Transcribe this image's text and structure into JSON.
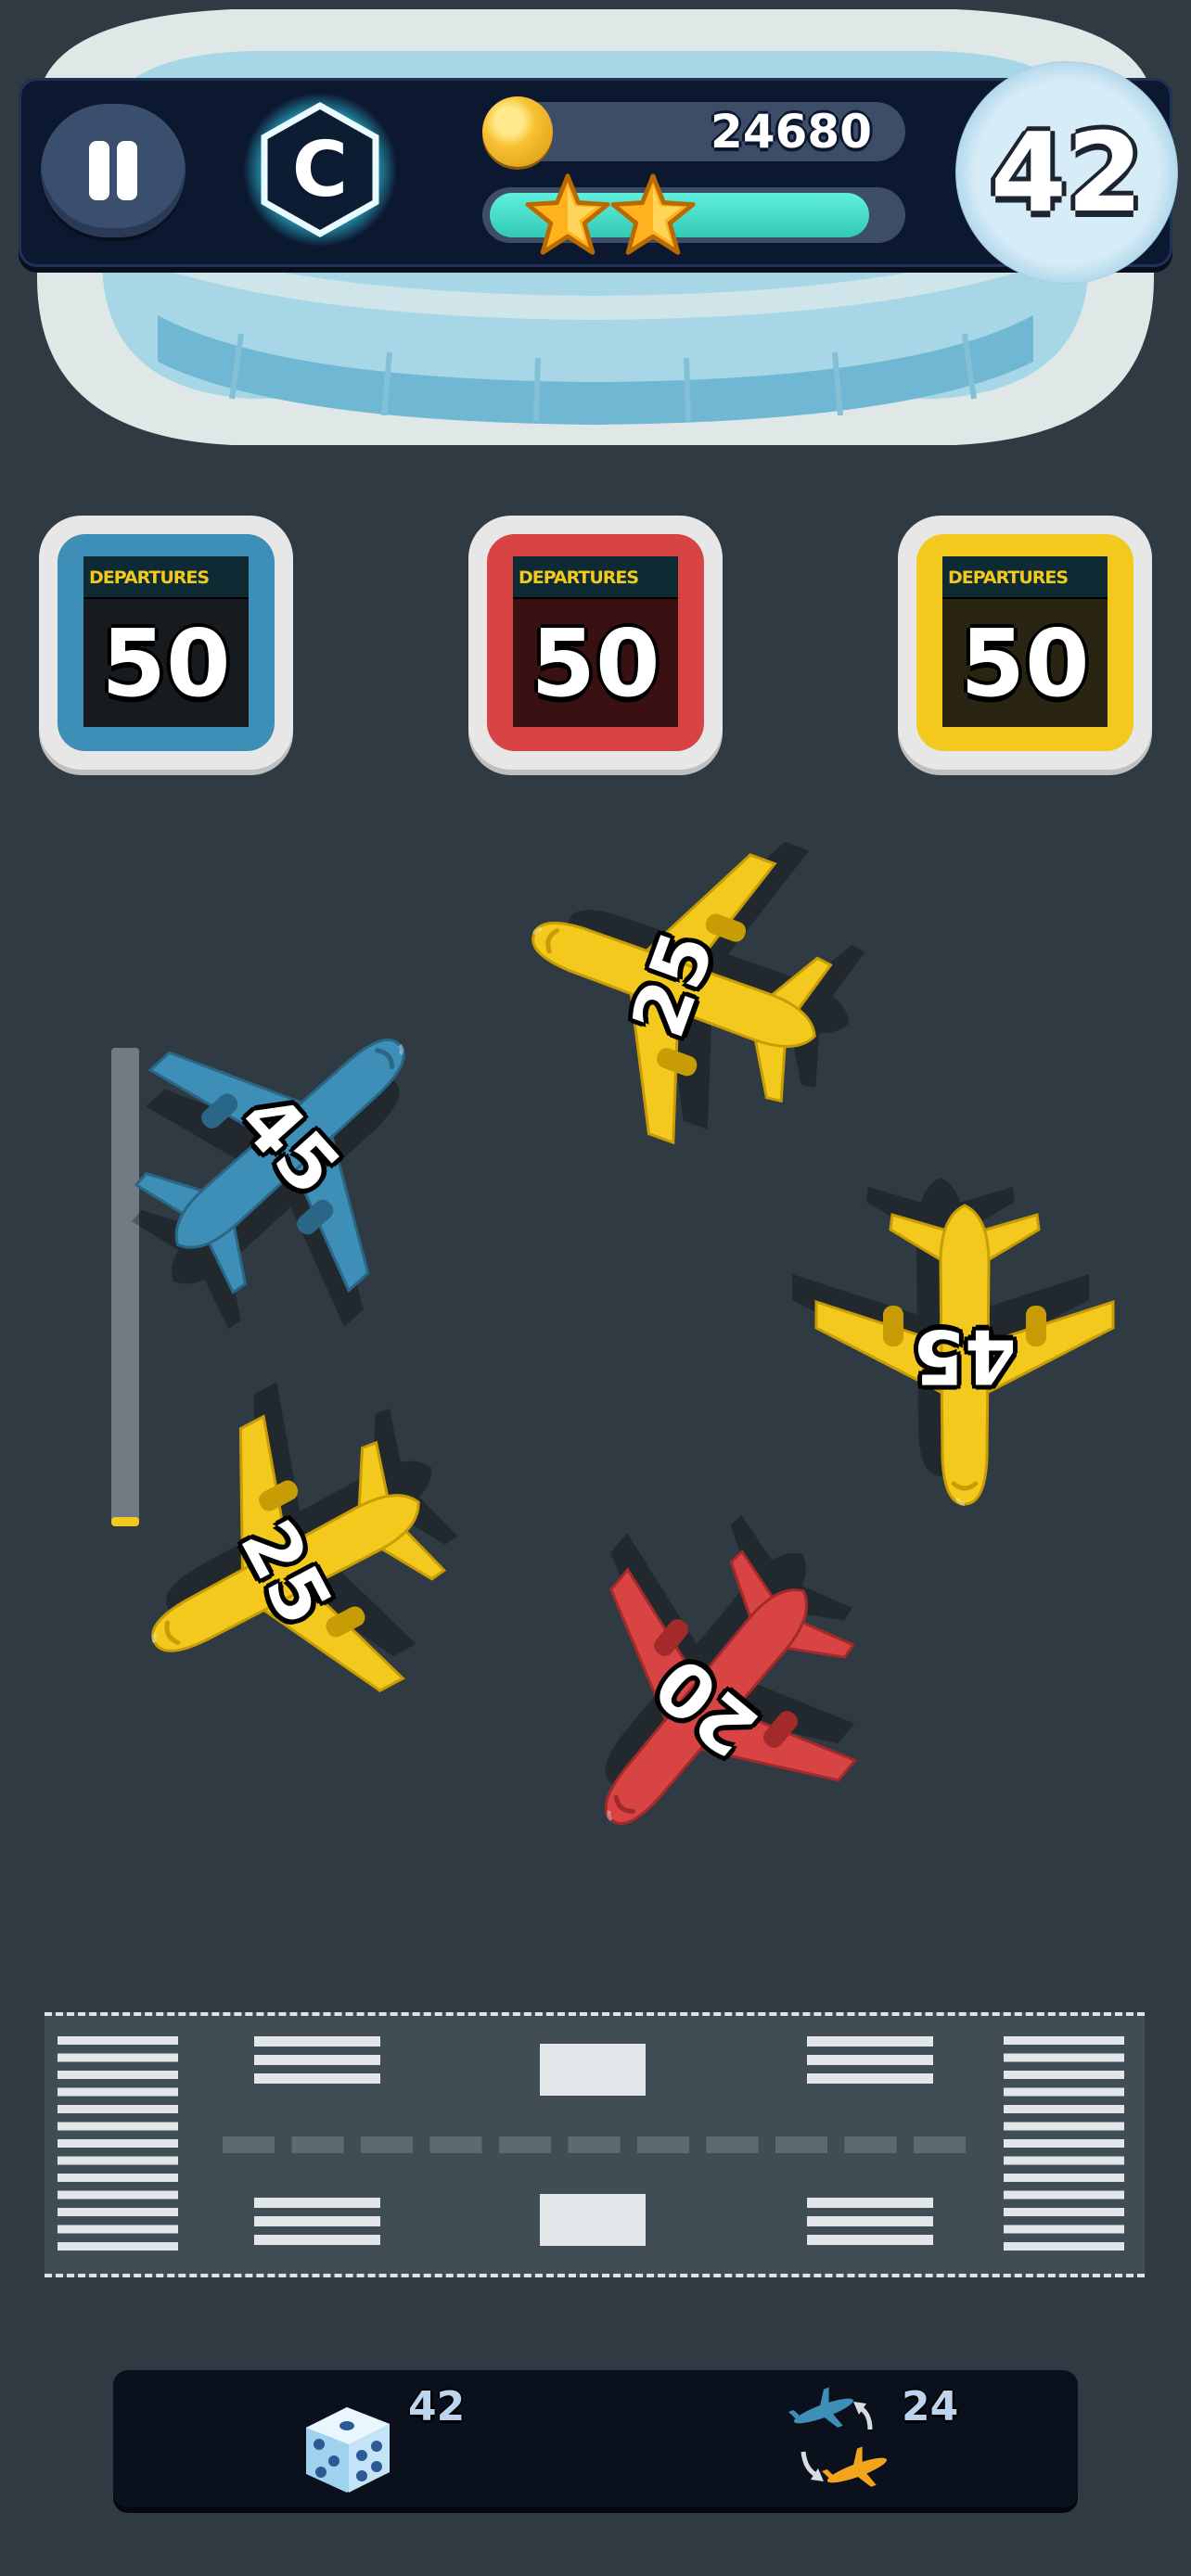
{
  "hud": {
    "pause_icon": "pause-icon",
    "rank_letter": "C",
    "coins": "24680",
    "coin_icon": "coin-icon",
    "stars_earned": 2,
    "star_progress": 0.93,
    "moves_left": "42"
  },
  "departures": [
    {
      "label": "DEPARTURES",
      "count": "50",
      "color": "#3e8fb7"
    },
    {
      "label": "DEPARTURES",
      "count": "50",
      "color": "#d84443"
    },
    {
      "label": "DEPARTURES",
      "count": "50",
      "color": "#f2c91c"
    }
  ],
  "planes": [
    {
      "number": "25",
      "color": "yellow"
    },
    {
      "number": "45",
      "color": "blue"
    },
    {
      "number": "45",
      "color": "yellow"
    },
    {
      "number": "25",
      "color": "yellow"
    },
    {
      "number": "20",
      "color": "red"
    }
  ],
  "queue": {
    "fill": 0.02
  },
  "powerups": {
    "shuffle": {
      "icon": "dice-icon",
      "count": "42"
    },
    "swap": {
      "icon": "swap-planes-icon",
      "count": "24"
    }
  },
  "colors": {
    "background": "#2f3a42",
    "blue": "#3e8fb7",
    "red": "#d84443",
    "yellow": "#f2c91c",
    "hud": "#0c1830"
  }
}
